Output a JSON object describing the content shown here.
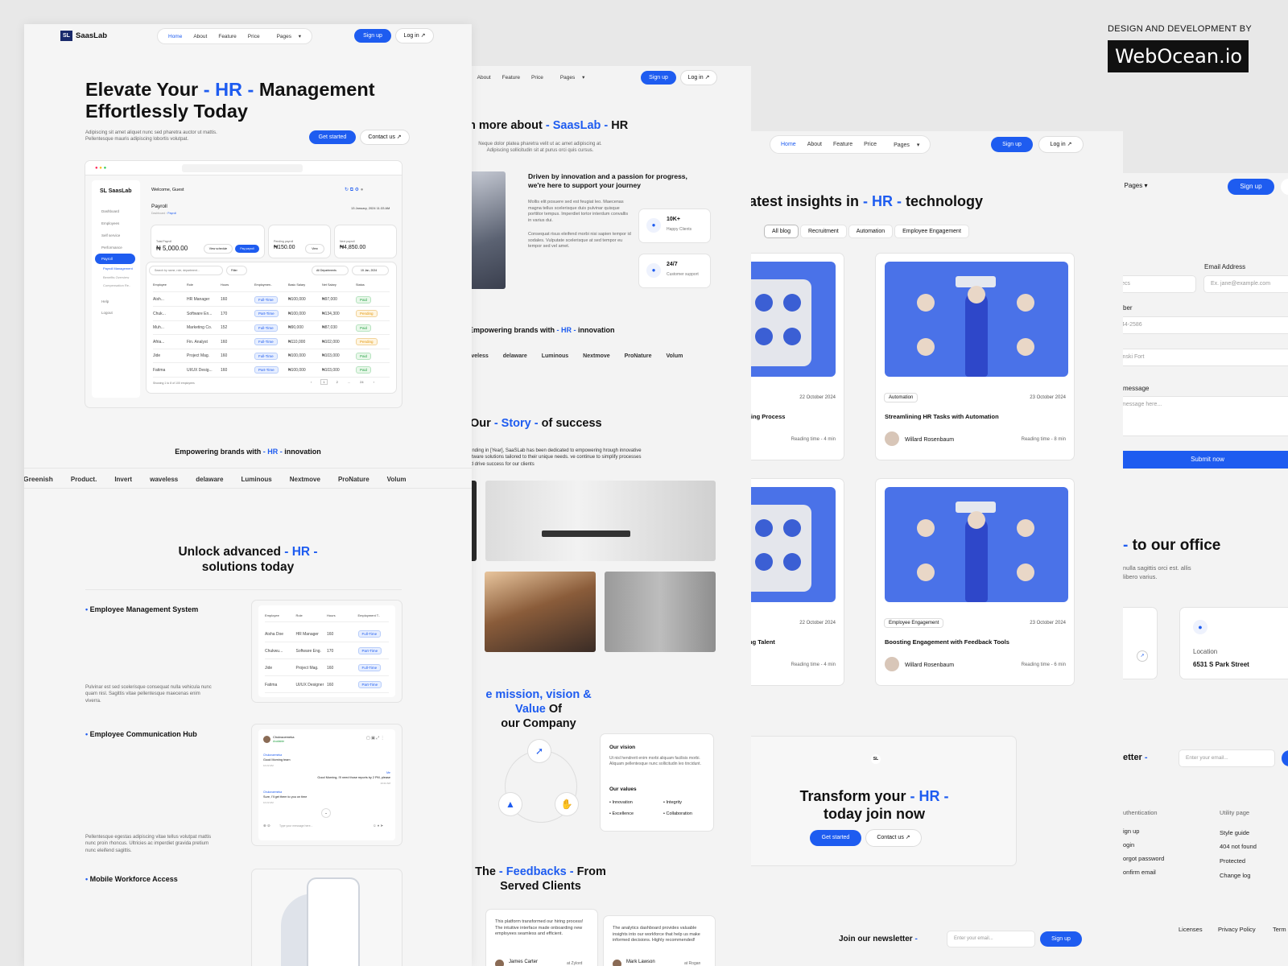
{
  "brand": {
    "credit_line": "DESIGN AND DEVELOPMENT BY",
    "credit_name": "WebOcean.io"
  },
  "nav": {
    "home": "Home",
    "about": "About",
    "feature": "Feature",
    "price": "Price",
    "pages": "Pages",
    "signup": "Sign up",
    "login": "Log in"
  },
  "p1": {
    "logo": "SaasLab",
    "hero_title_1": "Elevate Your ",
    "hero_hl": "- HR -",
    "hero_title_2": " Management",
    "hero_title_3": "Effortlessly Today",
    "hero_sub": "Adipiscing sit amet aliquet nunc sed pharetra auctor ut mattis. Pellentesque mauris adipiscing lobortis volutpat.",
    "get_started": "Get started",
    "contact": "Contact us",
    "dash": {
      "welcome": "Welcome, Guest",
      "payroll": "Payroll",
      "crumb": "Dashboard",
      "crumb2": "Payroll",
      "date": "13 January, 2024 11:33 AM",
      "menu": [
        "Dashboard",
        "Employees",
        "Self service",
        "Performance",
        "Payroll",
        "Payroll Management",
        "Benefits Overview",
        "Compensation Re..",
        "Help",
        "Logout"
      ],
      "stat1_title": "Total Payroll",
      "stat1_val": "₦ 5,000.00",
      "stat2_title": "Pending payroll",
      "stat2_val": "₦150.00",
      "stat3_title": "Next payroll",
      "stat3_val": "₦4,850.00",
      "view_schedule": "View schedule",
      "pay_payroll": "Pay payroll",
      "view": "View",
      "search": "Search by name, role, department...",
      "filter": "Filter",
      "all_departments": "All Departments",
      "date_pick": "15 Jan, 2024",
      "cols": [
        "Employee",
        "Role",
        "Hours",
        "Employmen..",
        "Basic Salary",
        "Net Salary",
        "Status"
      ],
      "rows": [
        {
          "name": "Aish...",
          "role": "HR Manager",
          "hours": "160",
          "type": "Full-Time",
          "basic": "₦100,000",
          "net": "₦97,000",
          "status": "Paid"
        },
        {
          "name": "Chuk...",
          "role": "Software En...",
          "hours": "170",
          "type": "Part-Time",
          "basic": "₦100,000",
          "net": "₦134,300",
          "status": "Pending"
        },
        {
          "name": "Muh...",
          "role": "Marketing Co.",
          "hours": "152",
          "type": "Full-Time",
          "basic": "₦90,000",
          "net": "₦87,030",
          "status": "Paid"
        },
        {
          "name": "Afria...",
          "role": "Fin. Analyst",
          "hours": "160",
          "type": "Full-Time",
          "basic": "₦110,000",
          "net": "₦102,000",
          "status": "Pending"
        },
        {
          "name": "Jide",
          "role": "Project Mag.",
          "hours": "160",
          "type": "Full-Time",
          "basic": "₦100,000",
          "net": "₦103,000",
          "status": "Paid"
        },
        {
          "name": "Fatima",
          "role": "UI/UX Desig...",
          "hours": "160",
          "type": "Part-Time",
          "basic": "₦100,000",
          "net": "₦103,000",
          "status": "Paid"
        }
      ],
      "showing": "Showing 1 to 8 of 100 employees",
      "pages": [
        "1",
        "2",
        "...",
        "24"
      ]
    },
    "brands_title_1": "Empowering brands with ",
    "brands_hl": "- HR -",
    "brands_title_2": " innovation",
    "brands": [
      "Greenish",
      "Product.",
      "Invert",
      "waveless",
      "delaware",
      "Luminous",
      "Nextmove",
      "ProNature",
      "Volum"
    ],
    "unlock_1": "Unlock advanced ",
    "unlock_hl": "- HR -",
    "unlock_2": "solutions today",
    "f1_title": "Employee Management System",
    "f1_desc": "Pulvinar est sed scelerisque consequat nulla vehicula nunc quam nisl. Sagittis vitae pellentesque maecenas enim viverra.",
    "f2_title": "Employee Communication Hub",
    "f2_desc": "Pellentesque egestas adipiscing vitae tellus volutpat mattis nunc proin rhoncus. Ultricies ac imperdiet gravida pretium nunc eleifend sagittis.",
    "f3_title": "Mobile Workforce Access",
    "mini_cols": [
      "Employee",
      "Role",
      "Hours",
      "Employment T.."
    ],
    "mini_rows": [
      {
        "name": "Aisha Doe",
        "role": "HR Manager",
        "hours": "160",
        "type": "Full-Time"
      },
      {
        "name": "Chukwu...",
        "role": "Software Eng.",
        "hours": "170",
        "type": "Part-Time"
      },
      {
        "name": "Jide",
        "role": "Project Mag.",
        "hours": "160",
        "type": "Full-Time"
      },
      {
        "name": "Fatima",
        "role": "UI/UX Designer",
        "hours": "160",
        "type": "Part-Time"
      }
    ],
    "chat": {
      "name": "Chukwuemeka",
      "status": "Available",
      "m1_name": "Chukwuemeka",
      "m1": "Good Morning team",
      "m1_t": "10:22 AM",
      "me": "Me",
      "m2": "Good Morning, I'll need those reports by 2 PM, please",
      "m2_t": "10:22 AM",
      "m3_name": "Chukwuemeka",
      "m3": "Sure, I'll get them to you on time",
      "m3_t": "10:22 AM",
      "placeholder": "Type your message here..."
    }
  },
  "p2": {
    "title_1": "n more about ",
    "title_hl": "- SaasLab -",
    "title_2": " HR",
    "sub": "Neque dolor platea pharetra velit ut ac amet adipiscing at. Adipiscing sollicitudin sit at purus orci quis cursus.",
    "drive_title": "Driven by innovation and a passion for progress, we're here to support your journey",
    "drive_p1": "Mollis elit posuere sed est feugiat leo. Maecenas magna tellus scelerisque duis pulvinar quisque porttitor tempus. Imperdiet tortor interdum convallis in varius dui.",
    "drive_p2": "Consequat risus eleifend morbi nisi sapien tempor id sodales. Vulputate scelerisque at sed tempor eu tempor sed vel amet.",
    "stat1_val": "10K+",
    "stat1_lbl": "Happy Clients",
    "stat2_val": "24/7",
    "stat2_lbl": "Customer support",
    "brands_1": "Empowering brands with ",
    "brands_hl": "- HR -",
    "brands_2": " innovation",
    "brands": [
      "waveless",
      "delaware",
      "Luminous",
      "Nextmove",
      "ProNature",
      "Volum"
    ],
    "story_1": "Our ",
    "story_hl": "- Story -",
    "story_2": " of success",
    "story_p": "founding in [Year], SaaSLab has been dedicated to empowering hrough innovative software solutions tailored to their unique needs. ve continue to simplify processes and drive success for our clients",
    "mission_hl": "e mission, vision & Value",
    "mission_2": " Of",
    "mission_3": "our Company",
    "vision_title": "Our vision",
    "vision_p": "Ut nisl hendrerit enim morbi aliquam facilisis morbi. Aliquam pellentesque nunc sollicitudin leo tincidunt.",
    "values_title": "Our values",
    "values": [
      "Innovation",
      "Integrity",
      "Excellence",
      "Collaboration"
    ],
    "fb_1": "The ",
    "fb_hl": "- Feedbacks -",
    "fb_2": " From",
    "fb_3": "Served Clients",
    "fb1_text": "This platform transformed our hiring process! The intuitive interface made onboarding new employees seamless and efficient.",
    "fb1_name": "James Carter",
    "fb1_co": "at Zylord",
    "fb2_text": "The analytics dashboard provides valuable insights into our workforce that help us make informed decisions. Highly recommended!",
    "fb2_name": "Mark Lawson",
    "fb2_co": "at Rogan"
  },
  "p3": {
    "title_1": "atest insights in ",
    "title_hl": "- HR -",
    "title_2": " technology",
    "chips": [
      "All blog",
      "Recruitment",
      "Automation",
      "Employee Engagement"
    ],
    "c1_date": "22 October 2024",
    "c1_title": "ring Process",
    "c1_read": "Reading time - 4 min",
    "c2_tag": "Automation",
    "c2_date": "23 October 2024",
    "c2_title": "Streamlining HR Tasks with Automation",
    "c2_author": "Willard Rosenbaum",
    "c2_read": "Reading time - 8 min",
    "c3_date": "22 October 2024",
    "c3_title": "ng Talent",
    "c3_read": "Reading time - 4 min",
    "c4_tag": "Employee Engagement",
    "c4_date": "23 October 2024",
    "c4_title": "Boosting Engagement with Feedback Tools",
    "c4_author": "Willard Rosenbaum",
    "c4_read": "Reading time - 6 min",
    "cta_1": "Transform your ",
    "cta_hl": "- HR -",
    "cta_2": "today join now",
    "get_started": "Get started",
    "contact": "Contact us",
    "newsletter": "Join our newsletter ",
    "newsletter_hl": "-",
    "email_ph": "Enter your email...",
    "signup": "Sign up"
  },
  "p4": {
    "pages": "Pages",
    "signup": "Sign up",
    "email_label": "Email Address",
    "email_ph": "Ex. jane@example.com",
    "name_ph": "ecs",
    "phone_label": "ber",
    "phone_ph": "44-2586",
    "addr_ph": "inski Fort",
    "msg_label": "message",
    "msg_ph": "message here...",
    "submit": "Submit now",
    "office_hl": "-",
    "office": " to our office",
    "office_p": "nulla sagittis orci est. allis libero varius.",
    "loc_label": "Location",
    "loc_val": "6531 S Park Street",
    "nl": "etter ",
    "nl_hl": "-",
    "nl_ph": "Enter your email...",
    "col1_title": "uthentication",
    "col1": [
      "ign up",
      "ogin",
      "orgot password",
      "onfirm email"
    ],
    "col2_title": "Utility page",
    "col2": [
      "Style guide",
      "404 not found",
      "Protected",
      "Change log"
    ],
    "foot": [
      "Licenses",
      "Privacy Policy",
      "Term"
    ]
  }
}
